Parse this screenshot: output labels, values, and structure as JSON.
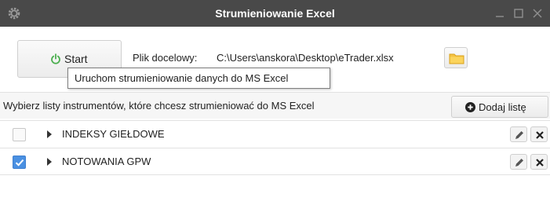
{
  "window": {
    "title": "Strumieniowanie Excel",
    "controls": [
      "minimize-icon",
      "maximize-icon",
      "close-icon"
    ],
    "icon": "gear-icon"
  },
  "toolbar": {
    "start_label": "Start",
    "start_icon": "power-icon",
    "target_label": "Plik docelowy:",
    "target_path": "C:\\Users\\anskora\\Desktop\\eTrader.xlsx",
    "folder_icon": "folder-icon",
    "start_tooltip": "Uruchom strumieniowanie danych do MS Excel"
  },
  "lists": {
    "hint": "Wybierz listy instrumentów, które chcesz strumieniować do MS Excel",
    "add_label": "Dodaj listę",
    "add_icon": "plus-circle-icon",
    "items": [
      {
        "label": "INDEKSY GIEŁDOWE",
        "checked": false
      },
      {
        "label": "NOTOWANIA GPW",
        "checked": true
      }
    ]
  },
  "colors": {
    "titlebar_bg": "#494949",
    "folder_icon": "#f5c242",
    "checkbox_checked": "#4a90e2",
    "start_icon": "#4caf50"
  }
}
